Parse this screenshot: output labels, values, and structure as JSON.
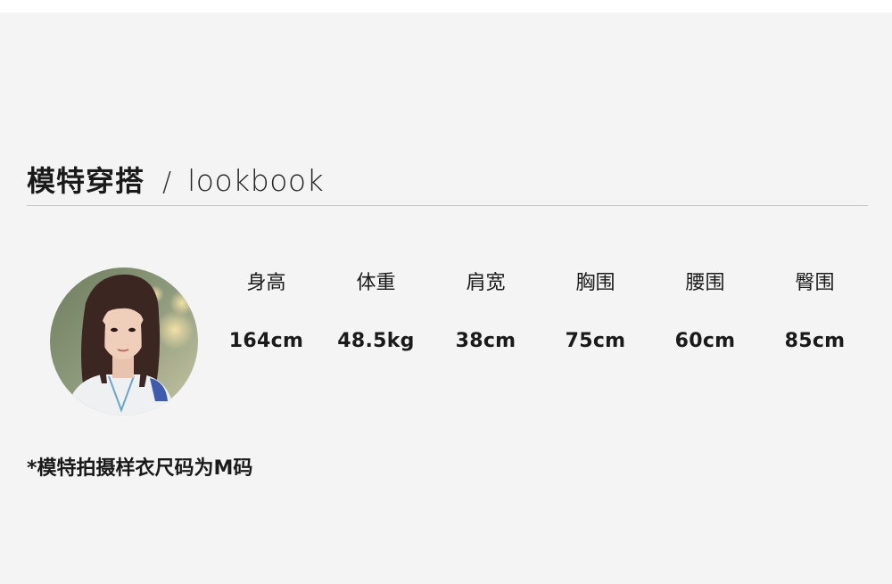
{
  "header": {
    "title_cn": "模特穿搭",
    "separator": "/",
    "title_en": "lookbook"
  },
  "model": {
    "avatar_icon": "model-portrait-photo",
    "measurements": [
      {
        "label": "身高",
        "value": "164cm"
      },
      {
        "label": "体重",
        "value": "48.5kg"
      },
      {
        "label": "肩宽",
        "value": "38cm"
      },
      {
        "label": "胸围",
        "value": "75cm"
      },
      {
        "label": "腰围",
        "value": "60cm"
      },
      {
        "label": "臀围",
        "value": "85cm"
      }
    ]
  },
  "note": "*模特拍摄样衣尺码为M码",
  "colors": {
    "panel_bg": "#f4f4f4",
    "divider": "#c8c8c8",
    "text": "#1a1a1a"
  }
}
